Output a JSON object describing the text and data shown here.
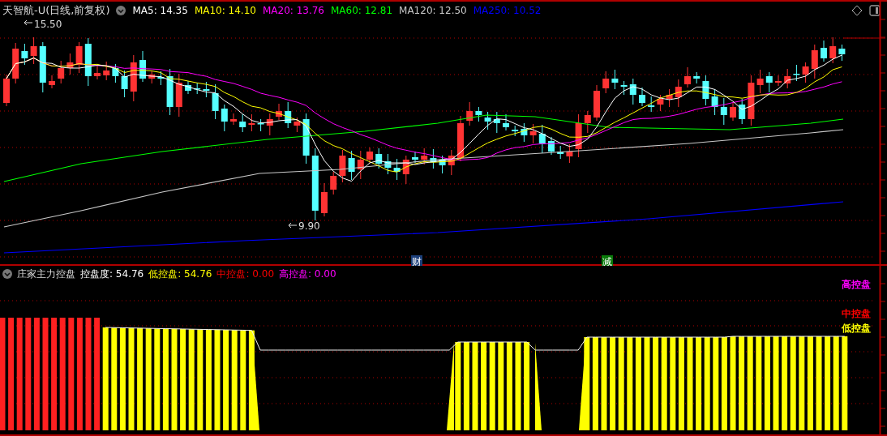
{
  "price_panel": {
    "title": "天智航-U(日线,前复权)",
    "indicators": [
      {
        "label": "MA5: 14.35",
        "color": "#ffffff"
      },
      {
        "label": "MA10: 14.10",
        "color": "#ffff00"
      },
      {
        "label": "MA20: 13.76",
        "color": "#ff00ff"
      },
      {
        "label": "MA60: 12.81",
        "color": "#00ff00"
      },
      {
        "label": "MA120: 12.50",
        "color": "#c8c8c8"
      },
      {
        "label": "MA250: 10.52",
        "color": "#0000ff"
      }
    ],
    "high_label": "15.50",
    "low_label": "9.90",
    "markers": [
      {
        "text": "财",
        "color": "#1c3f7a"
      },
      {
        "text": "减",
        "color": "#0a7a0a"
      }
    ]
  },
  "indicator_panel": {
    "title": "庄家主力控盘",
    "readings": [
      {
        "label": "控盘度: 54.76",
        "color": "#ffffff"
      },
      {
        "label": "低控盘: 54.76",
        "color": "#ffff00"
      },
      {
        "label": "中控盘: 0.00",
        "color": "#ff0000"
      },
      {
        "label": "高控盘: 0.00",
        "color": "#ff00ff"
      }
    ],
    "legend": [
      {
        "text": "高控盘",
        "color": "#ff00ff"
      },
      {
        "text": "中控盘",
        "color": "#ff0000"
      },
      {
        "text": "低控盘",
        "color": "#ffff00"
      }
    ]
  }
}
